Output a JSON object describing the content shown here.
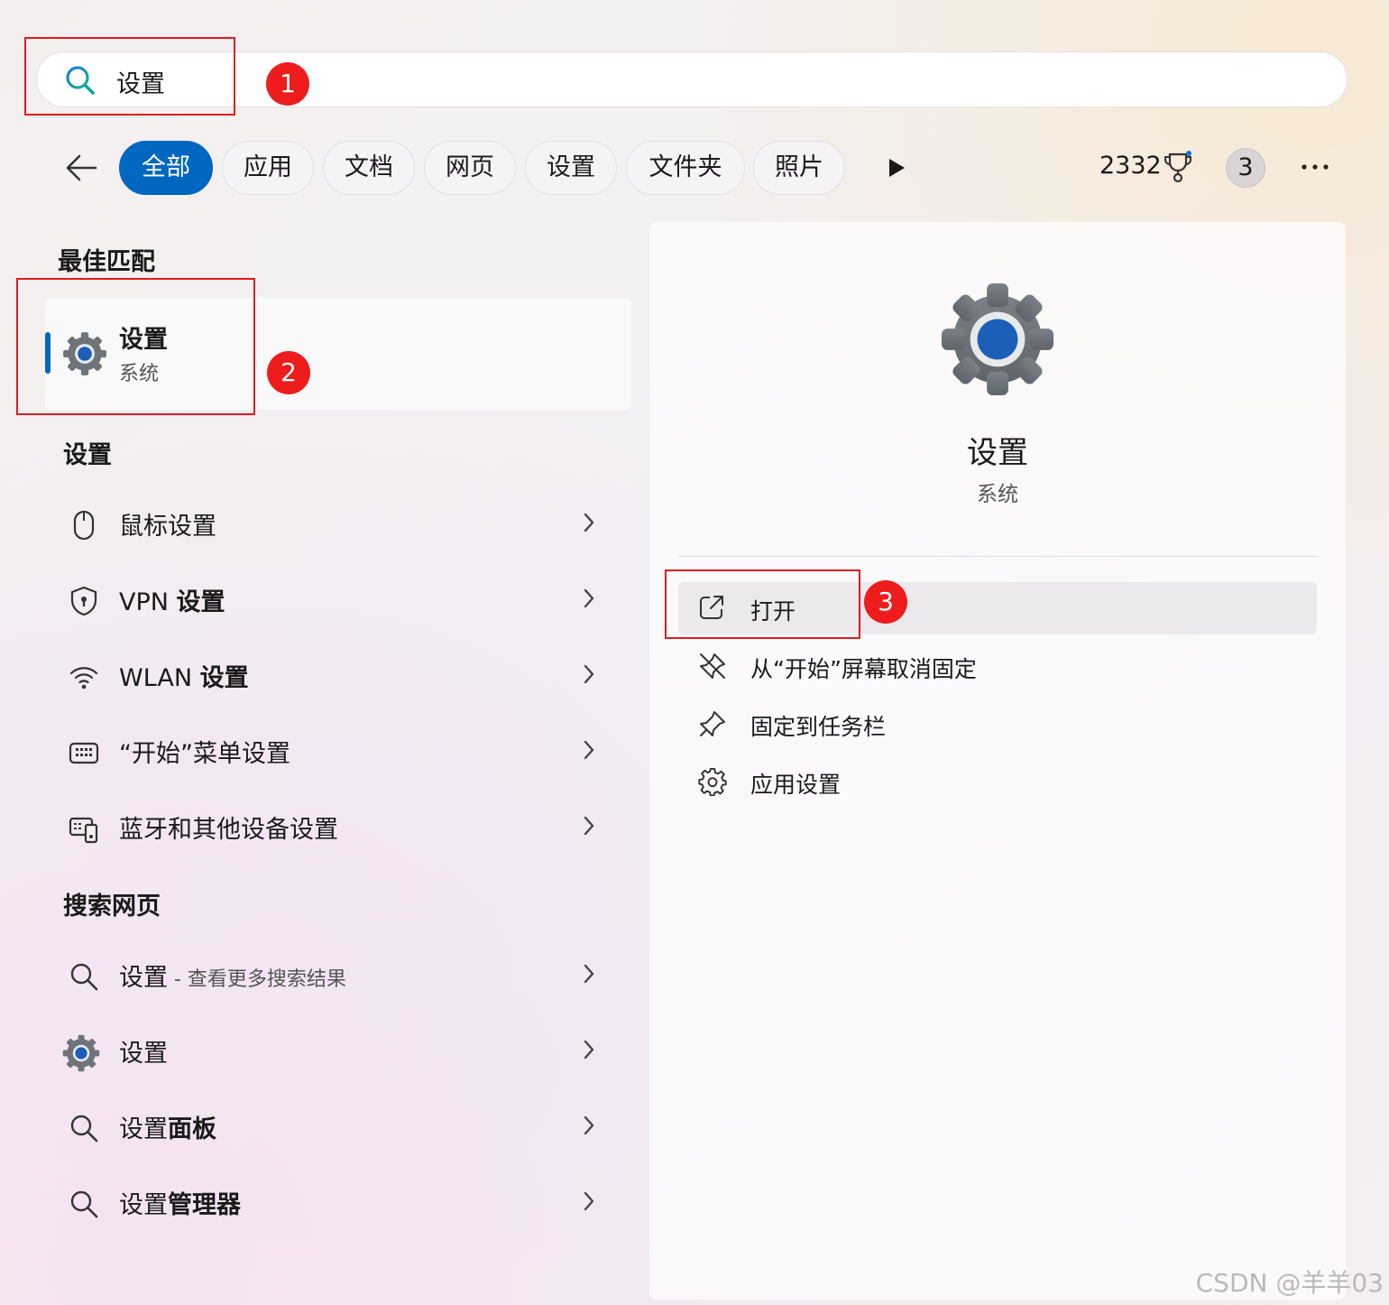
{
  "search": {
    "query": "设置"
  },
  "filters": {
    "chips": [
      "全部",
      "应用",
      "文档",
      "网页",
      "设置",
      "文件夹",
      "照片"
    ],
    "points": "2332",
    "notifications": "3"
  },
  "annotations": [
    "1",
    "2",
    "3"
  ],
  "best_match": {
    "section_title": "最佳匹配",
    "title": "设置",
    "subtitle": "系统"
  },
  "settings_section": {
    "title": "设置",
    "items": [
      {
        "label": "鼠标设置",
        "icon": "mouse-icon"
      },
      {
        "label_plain": "VPN ",
        "label_bold": "设置",
        "icon": "shield-icon"
      },
      {
        "label_plain": "WLAN ",
        "label_bold": "设置",
        "icon": "wifi-icon"
      },
      {
        "label": "“开始”菜单设置",
        "icon": "start-menu-icon"
      },
      {
        "label": "蓝牙和其他设备设置",
        "icon": "devices-icon"
      }
    ]
  },
  "web_section": {
    "title": "搜索网页",
    "items": [
      {
        "label": "设置",
        "suffix": " - 查看更多搜索结果",
        "icon": "search-icon"
      },
      {
        "label": "设置",
        "icon": "settings-gear-icon"
      },
      {
        "label_plain": "设置",
        "label_bold": "面板",
        "icon": "search-icon"
      },
      {
        "label_plain": "设置",
        "label_bold": "管理器",
        "icon": "search-icon"
      }
    ]
  },
  "detail": {
    "title": "设置",
    "subtitle": "系统",
    "actions": [
      {
        "label": "打开",
        "icon": "open-external-icon"
      },
      {
        "label": "从“开始”屏幕取消固定",
        "icon": "unpin-icon"
      },
      {
        "label": "固定到任务栏",
        "icon": "pin-icon"
      },
      {
        "label": "应用设置",
        "icon": "gear-icon"
      }
    ]
  },
  "watermark": "CSDN @羊羊03",
  "colors": {
    "accent": "#0067c0",
    "annotation_red": "#e51b1b"
  }
}
